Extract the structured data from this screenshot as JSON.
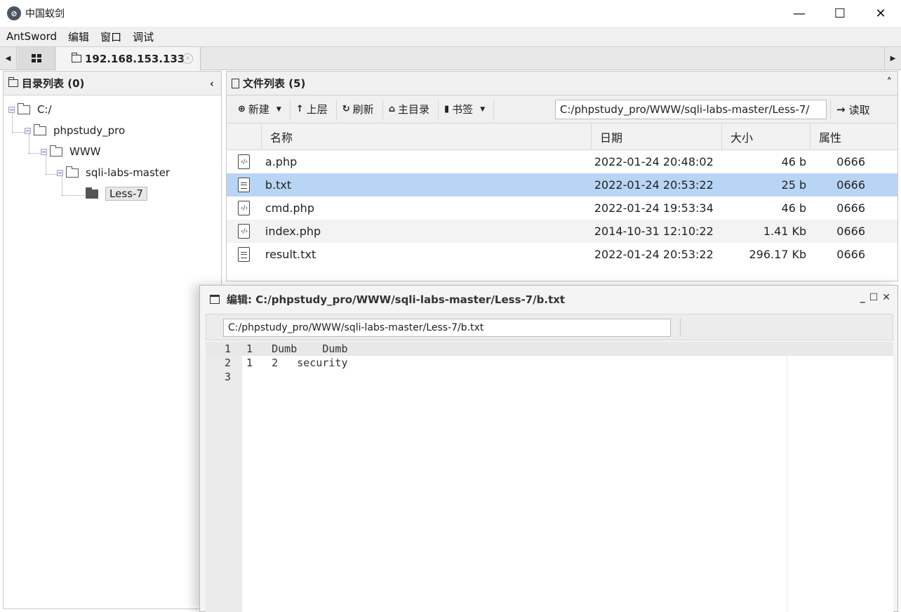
{
  "window": {
    "title": "中国蚁剑",
    "minimize": "—",
    "maximize": "☐",
    "close": "✕"
  },
  "menu": [
    "AntSword",
    "编辑",
    "窗口",
    "调试"
  ],
  "tabs": {
    "active_label": "192.168.153.133"
  },
  "dir_panel": {
    "title": "目录列表 (0)",
    "tree": [
      {
        "label": "C:/",
        "level": 0
      },
      {
        "label": "phpstudy_pro",
        "level": 1
      },
      {
        "label": "WWW",
        "level": 2
      },
      {
        "label": "sqli-labs-master",
        "level": 3
      },
      {
        "label": "Less-7",
        "level": 4,
        "selected": true
      }
    ]
  },
  "file_panel": {
    "title": "文件列表 (5)",
    "toolbar": {
      "new": "新建",
      "up": "上层",
      "refresh": "刷新",
      "home": "主目录",
      "bookmark": "书签",
      "path": "C:/phpstudy_pro/WWW/sqli-labs-master/Less-7/",
      "read": "读取"
    },
    "columns": {
      "name": "名称",
      "date": "日期",
      "size": "大小",
      "attr": "属性"
    },
    "files": [
      {
        "icon": "php-file-icon",
        "name": "a.php",
        "date": "2022-01-24 20:48:02",
        "size": "46 b",
        "attr": "0666"
      },
      {
        "icon": "text-file-icon",
        "name": "b.txt",
        "date": "2022-01-24 20:53:22",
        "size": "25 b",
        "attr": "0666"
      },
      {
        "icon": "php-file-icon",
        "name": "cmd.php",
        "date": "2022-01-24 19:53:34",
        "size": "46 b",
        "attr": "0666"
      },
      {
        "icon": "php-file-icon",
        "name": "index.php",
        "date": "2014-10-31 12:10:22",
        "size": "1.41 Kb",
        "attr": "0666"
      },
      {
        "icon": "text-file-icon",
        "name": "result.txt",
        "date": "2022-01-24 20:53:22",
        "size": "296.17 Kb",
        "attr": "0666"
      }
    ],
    "selected_file": "b.txt"
  },
  "editor": {
    "title": "编辑: C:/phpstudy_pro/WWW/sqli-labs-master/Less-7/b.txt",
    "path": "C:/phpstudy_pro/WWW/sqli-labs-master/Less-7/b.txt",
    "lines": [
      {
        "n": "1",
        "text": "1   Dumb    Dumb"
      },
      {
        "n": "2",
        "text": "1   2   security"
      },
      {
        "n": "3",
        "text": ""
      }
    ]
  }
}
